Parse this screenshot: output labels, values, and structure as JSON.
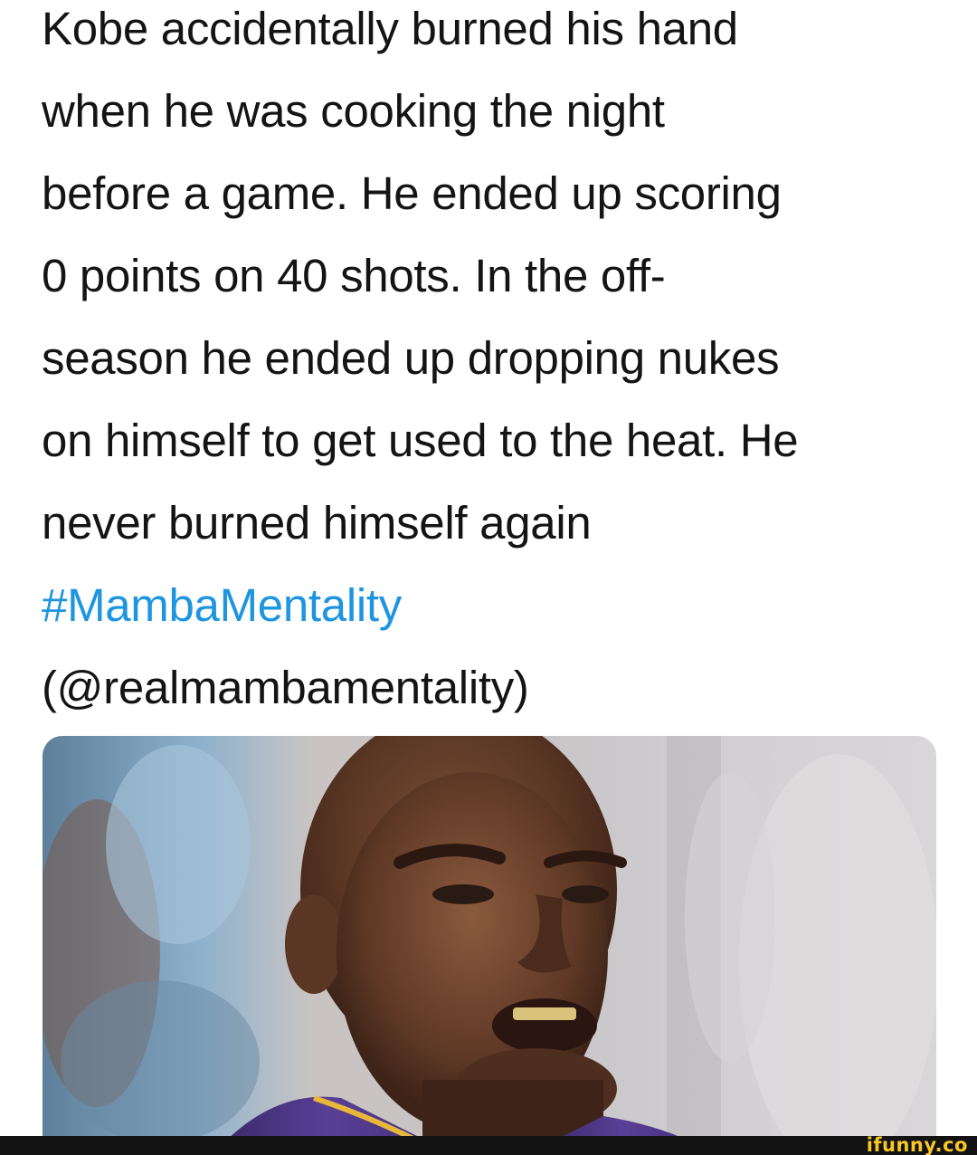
{
  "tweet": {
    "lines": [
      "Kobe accidentally burned his hand",
      "when he was cooking the night",
      "before a game. He ended up scoring",
      "0 points on 40 shots. In the off-",
      "season he ended up dropping nukes",
      "on himself to get used to the heat. He",
      "never burned himself again"
    ],
    "hashtag": "#MambaMentality",
    "handle": "(@realmambamentality)"
  },
  "media": {
    "subject": "photo of a basketball player grimacing"
  },
  "watermark": {
    "text": "ifunny.co"
  },
  "colors": {
    "text": "#141414",
    "hashtag": "#1d95e0",
    "watermark": "#f7c824",
    "footer": "#131313"
  }
}
